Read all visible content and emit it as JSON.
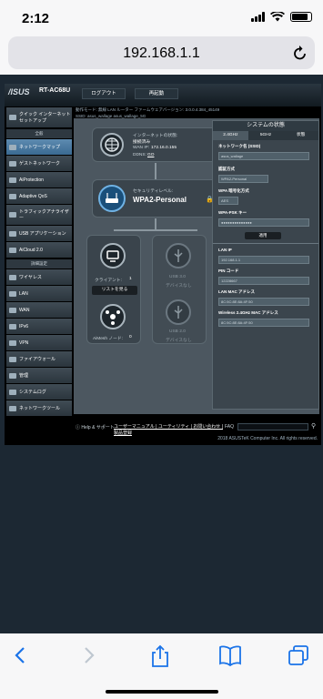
{
  "status": {
    "time": "2:12"
  },
  "browser": {
    "url": "192.168.1.1"
  },
  "router": {
    "logo": "/ISUS",
    "model": "RT-AC68U",
    "logout_label": "ログアウト",
    "reboot_label": "再起動",
    "fw_line": "動作モード: 無線 LAN ルーター  ファームウェアバージョン: 3.0.0.4.384_45149",
    "ssid_line": "SSID: asus_wallage  asus_wallage_5G",
    "sidebar": {
      "quick": "クイック インターネットセットアップ",
      "general_head": "全般",
      "items": [
        "ネットワークマップ",
        "ゲストネットワーク",
        "AiProtection",
        "Adaptive QoS",
        "トラフィックアナライザー",
        "USB アプリケーション",
        "AiCloud 2.0"
      ],
      "advanced_head": "詳細設定",
      "adv_items": [
        "ワイヤレス",
        "LAN",
        "WAN",
        "IPv6",
        "VPN",
        "ファイアウォール",
        "管理",
        "システムログ",
        "ネットワークツール"
      ]
    },
    "internet": {
      "status_label": "インターネットの状態:",
      "status_value": "接続済み",
      "wan_ip_label": "WAN IP:",
      "wan_ip": "172.16.0.155",
      "ddns_label": "DDNS:",
      "ddns_value": "GO"
    },
    "security": {
      "label": "セキュリティレベル:",
      "value": "WPA2-Personal"
    },
    "clients": {
      "label": "クライアント:",
      "count": "1",
      "view_btn": "リストを見る"
    },
    "usb1": {
      "label": "USB 3.0",
      "status": "デバイスなし"
    },
    "usb2": {
      "label": "USB 2.0",
      "status": "デバイスなし"
    },
    "aimesh": {
      "label": "AiMesh ノード:",
      "count": "0"
    },
    "panel": {
      "title": "システムの状態",
      "tabs": [
        "2.4GHz",
        "5GHz",
        "状態"
      ],
      "ssid_label": "ネットワーク名 (SSID)",
      "ssid_value": "asus_wallage",
      "auth_label": "認証方式",
      "auth_value": "WPA2-Personal",
      "enc_label": "WPA 暗号化方式",
      "enc_value": "AES",
      "psk_label": "WPA-PSK キー",
      "psk_value": "●●●●●●●●●●●●●●",
      "apply_btn": "適用",
      "lan_ip_label": "LAN IP",
      "lan_ip": "192.168.1.1",
      "pin_label": "PIN コード",
      "pin": "12228667",
      "lan_mac_label": "LAN MAC アドレス",
      "lan_mac": "8C:5C:8E:8A:4F:50",
      "wl_mac_label": "Wireless 2.4GHz MAC アドレス",
      "wl_mac": "8C:5C:8E:8A:4F:50"
    },
    "footer": {
      "help": "Help & サポート",
      "links": "ユーザーマニュアル | ユーティリティ | お問い合わせ | 製品登録",
      "faq": "FAQ",
      "copyright": "2018 ASUSTeK Computer Inc. All rights reserved."
    }
  }
}
